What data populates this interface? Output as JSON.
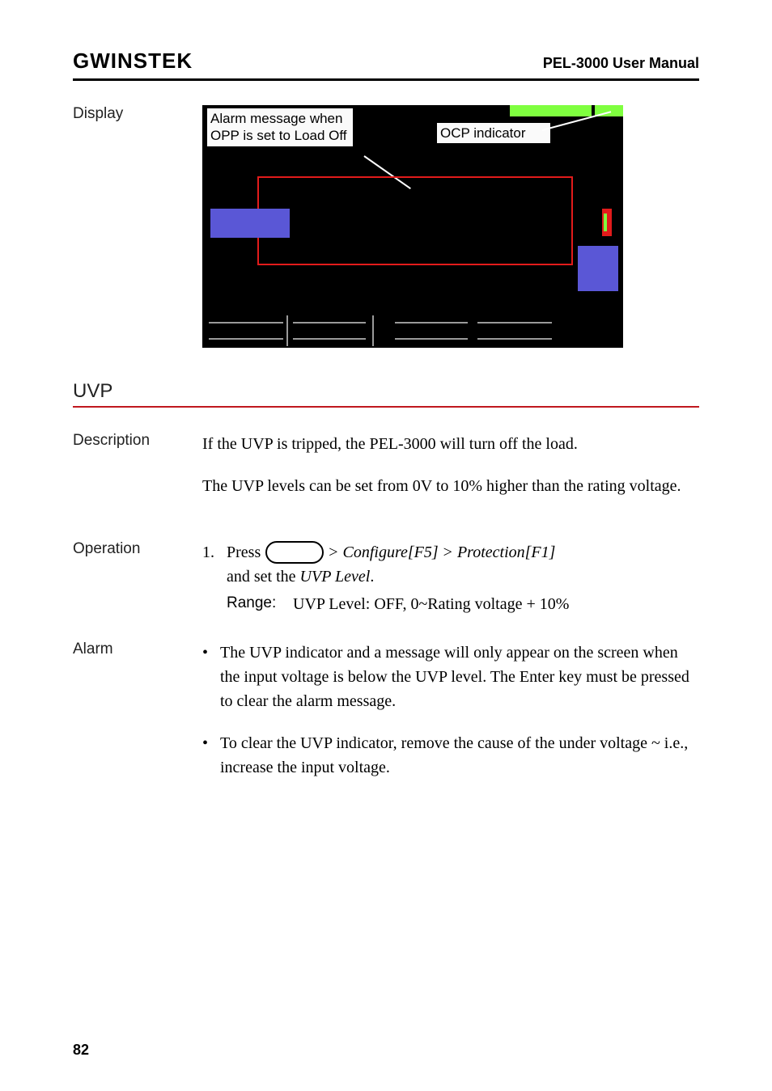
{
  "header": {
    "logo_main": "GWINSTEK",
    "manual_title": "PEL-3000 User Manual"
  },
  "display": {
    "label": "Display",
    "callout_alarm": "Alarm message when OPP is set to Load Off",
    "callout_ocp": "OCP indicator"
  },
  "uvp": {
    "title": "UVP",
    "description_label": "Description",
    "description_p1": "If the UVP is tripped, the PEL-3000 will turn off the load.",
    "description_p2": "The UVP levels can be set from 0V to 10% higher than the rating voltage.",
    "operation_label": "Operation",
    "op_num": "1.",
    "op_press": "Press",
    "op_path1": "Configure[F5]",
    "op_path2": "Protection[F1]",
    "op_setline_a": "and set the",
    "op_setline_b": "UVP Level",
    "op_setline_c": ".",
    "range_label": "Range:",
    "range_value": "UVP Level: OFF, 0~Rating voltage + 10%",
    "alarm_label": "Alarm",
    "alarm_b1": "The UVP indicator and a message will only appear on the screen when the input voltage is below the UVP level. The Enter key must be pressed to clear the alarm message.",
    "alarm_b2": "To clear the UVP indicator, remove the cause of the under voltage ~ i.e., increase the input voltage."
  },
  "page": "82"
}
